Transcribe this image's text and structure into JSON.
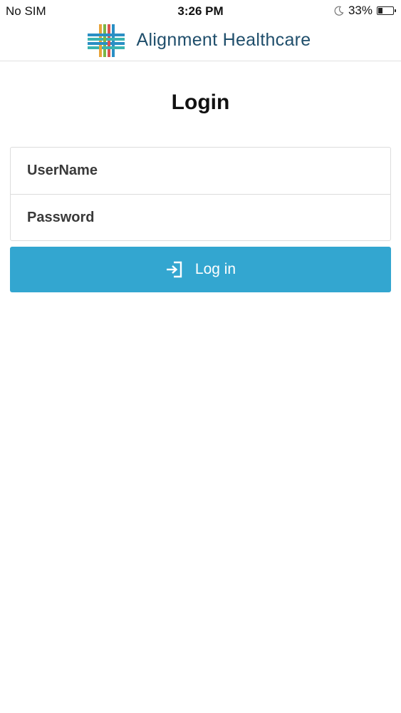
{
  "status_bar": {
    "carrier": "No SIM",
    "time": "3:26 PM",
    "battery_percent": "33%",
    "battery_level": 0.33,
    "icons": [
      "moon-icon",
      "battery-icon"
    ]
  },
  "header": {
    "brand_name": "Alignment Healthcare",
    "logo_icon": "alignment-logo"
  },
  "page": {
    "title": "Login"
  },
  "form": {
    "username_placeholder": "UserName",
    "username_value": "",
    "password_placeholder": "Password",
    "password_value": "",
    "login_label": "Log in",
    "login_icon": "login-icon"
  },
  "colors": {
    "button_bg": "#33a6d0",
    "brand_text": "#1f4e6b",
    "logo_blue": "#2a8fc4",
    "logo_orange": "#e8a33a",
    "logo_green": "#7ab648",
    "logo_red": "#d9534f"
  }
}
